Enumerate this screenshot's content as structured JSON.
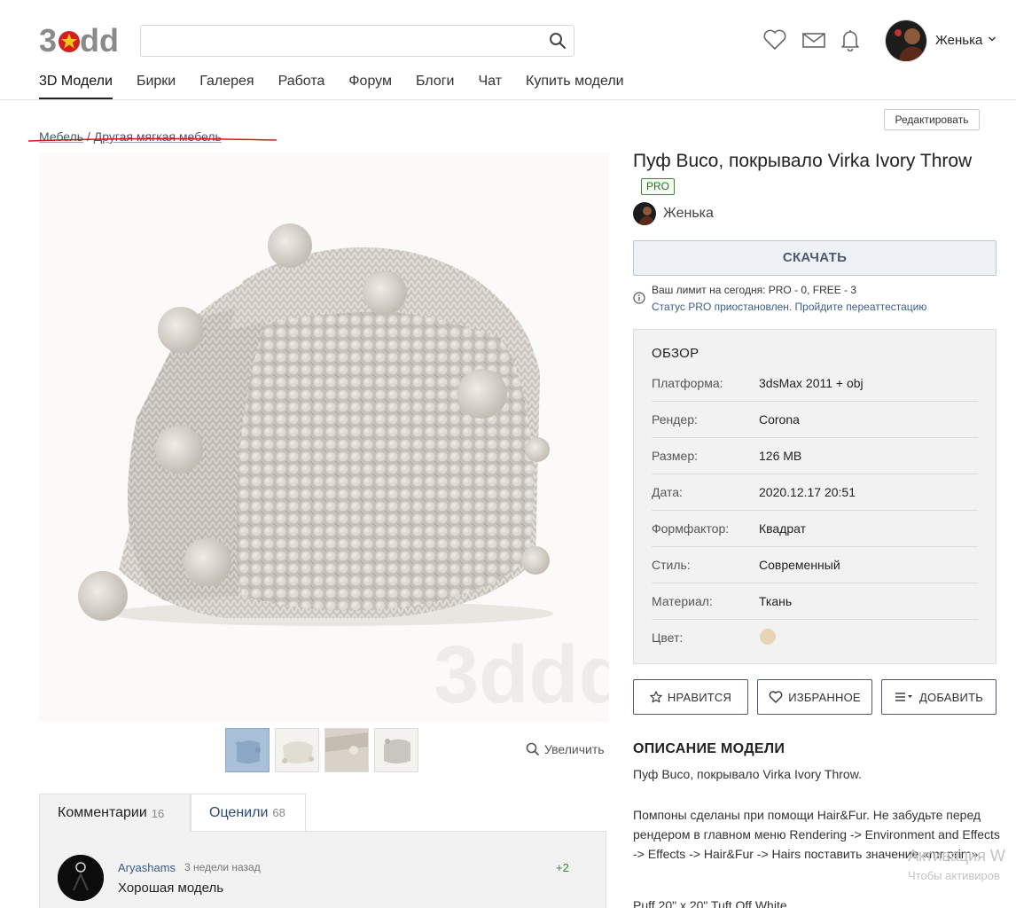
{
  "brand": {
    "logo_text": "3ddd",
    "accent": "#d22020"
  },
  "search": {
    "value": "",
    "placeholder": ""
  },
  "header": {
    "icons": [
      "heart-icon",
      "mail-icon",
      "bell-icon"
    ],
    "user_name": "Женька"
  },
  "nav": [
    "3D Модели",
    "Бирки",
    "Галерея",
    "Работа",
    "Форум",
    "Блоги",
    "Чат",
    "Купить модели"
  ],
  "edit_button": "Редактировать",
  "breadcrumb": {
    "level1": "Мебель",
    "separator": "/",
    "level2": "Другая мягкая мебель"
  },
  "gallery": {
    "watermark": "3ddd",
    "zoom_label": "Увеличить",
    "thumbnails_count": 4
  },
  "tabs": {
    "comments_label": "Комментарии",
    "comments_count": "16",
    "ratings_label": "Оценили",
    "ratings_count": "68"
  },
  "comment": {
    "author": "Aryashams",
    "time": "3 недели назад",
    "score": "+2",
    "text": "Хорошая модель"
  },
  "product": {
    "title": "Пуф Buco, покрывало Virka Ivory Throw",
    "badge": "PRO",
    "author": "Женька",
    "download_label": "СКАЧАТЬ",
    "limit_text": "Ваш лимит на сегодня: PRO - 0, FREE - 3",
    "status_text": "Статус PRO приостановлен. Пройдите переаттестацию"
  },
  "overview": {
    "title": "ОБЗОР",
    "rows": [
      {
        "label": "Платформа:",
        "value": "3dsMax 2011 + obj"
      },
      {
        "label": "Рендер:",
        "value": "Corona"
      },
      {
        "label": "Размер:",
        "value": "126 MB"
      },
      {
        "label": "Дата:",
        "value": "2020.12.17 20:51"
      },
      {
        "label": "Формфактор:",
        "value": "Квадрат"
      },
      {
        "label": "Стиль:",
        "value": "Современный"
      },
      {
        "label": "Материал:",
        "value": "Ткань"
      },
      {
        "label": "Цвет:",
        "value": "",
        "color": "#e8d4b4"
      }
    ]
  },
  "actions": {
    "like": "НРАВИТСЯ",
    "favorite": "ИЗБРАННОЕ",
    "add": "ДОБАВИТЬ"
  },
  "description": {
    "title": "ОПИСАНИЕ МОДЕЛИ",
    "line1": "Пуф Buco, покрывало Virka Ivory Throw.",
    "line2": "Помпоны сделаны при помощи Hair&Fur. Не забудьте перед рендером в главном меню Rendering -> Environment and Effects -> Effects -> Hair&Fur -> Hairs поставить значение «mr prim».",
    "line3": "Puff 20\" x 20\" Tuft Off White"
  },
  "os_overlay": {
    "line1": "Активация W",
    "line2": "Чтобы активиров"
  }
}
